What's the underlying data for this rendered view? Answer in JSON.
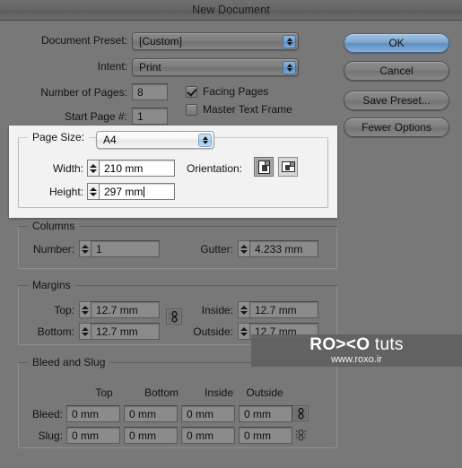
{
  "window": {
    "title": "New Document"
  },
  "buttons": {
    "ok": "OK",
    "cancel": "Cancel",
    "save_preset": "Save Preset...",
    "fewer_options": "Fewer Options"
  },
  "top": {
    "document_preset_label": "Document Preset:",
    "document_preset_value": "[Custom]",
    "intent_label": "Intent:",
    "intent_value": "Print",
    "number_of_pages_label": "Number of Pages:",
    "number_of_pages_value": "8",
    "start_page_label": "Start Page #:",
    "start_page_value": "1",
    "facing_pages_label": "Facing Pages",
    "facing_pages_checked": true,
    "master_text_frame_label": "Master Text Frame",
    "master_text_frame_checked": false
  },
  "page_size": {
    "group_title": "Page Size:",
    "preset_value": "A4",
    "width_label": "Width:",
    "width_value": "210 mm",
    "height_label": "Height:",
    "height_value": "297 mm",
    "orientation_label": "Orientation:",
    "orientation_selected": "portrait",
    "orientation_options": [
      "portrait",
      "landscape"
    ]
  },
  "columns": {
    "group_title": "Columns",
    "number_label": "Number:",
    "number_value": "1",
    "gutter_label": "Gutter:",
    "gutter_value": "4.233 mm"
  },
  "margins": {
    "group_title": "Margins",
    "top_label": "Top:",
    "top_value": "12.7 mm",
    "bottom_label": "Bottom:",
    "bottom_value": "12.7 mm",
    "inside_label": "Inside:",
    "inside_value": "12.7 mm",
    "outside_label": "Outside:",
    "outside_value": "12.7 mm",
    "link_icon": "chain-link-icon"
  },
  "bleed_slug": {
    "group_title": "Bleed and Slug",
    "columns": [
      "Top",
      "Bottom",
      "Inside",
      "Outside"
    ],
    "rows": [
      {
        "label": "Bleed:",
        "values": [
          "0 mm",
          "0 mm",
          "0 mm",
          "0 mm"
        ]
      },
      {
        "label": "Slug:",
        "values": [
          "0 mm",
          "0 mm",
          "0 mm",
          "0 mm"
        ]
      }
    ]
  },
  "watermark": {
    "brand_bold": "RO><O",
    "brand_light": "tuts",
    "url": "www.roxo.ir"
  },
  "colors": {
    "window_bg": "#787878",
    "titlebar": "#676767",
    "accent_blue": "#5f8fc0",
    "highlight_panel": "#f2f2f2"
  }
}
